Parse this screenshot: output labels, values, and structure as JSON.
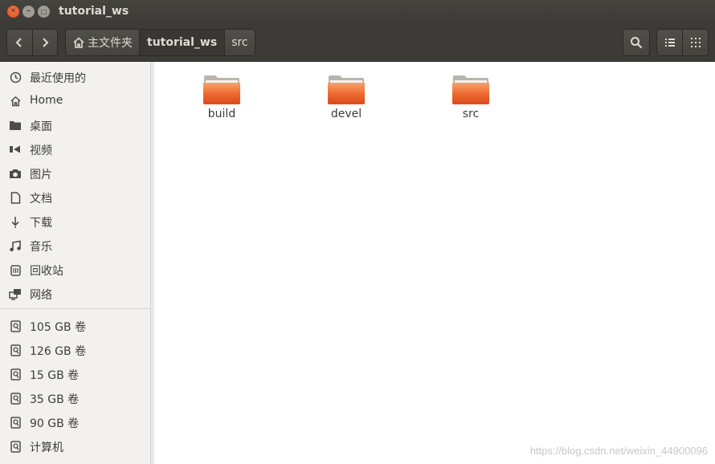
{
  "window": {
    "title": "tutorial_ws"
  },
  "toolbar": {
    "breadcrumbs": [
      {
        "label": "主文件夹"
      },
      {
        "label": "tutorial_ws"
      },
      {
        "label": "src"
      }
    ]
  },
  "sidebar": {
    "places": [
      {
        "label": "最近使用的",
        "icon": "clock-icon"
      },
      {
        "label": "Home",
        "icon": "home-icon"
      },
      {
        "label": "桌面",
        "icon": "desktop-folder-icon"
      },
      {
        "label": "视频",
        "icon": "video-icon"
      },
      {
        "label": "图片",
        "icon": "camera-icon"
      },
      {
        "label": "文档",
        "icon": "document-icon"
      },
      {
        "label": "下载",
        "icon": "download-icon"
      },
      {
        "label": "音乐",
        "icon": "music-icon"
      },
      {
        "label": "回收站",
        "icon": "trash-icon"
      },
      {
        "label": "网络",
        "icon": "network-icon"
      }
    ],
    "devices": [
      {
        "label": "105 GB 卷",
        "icon": "drive-icon"
      },
      {
        "label": "126 GB 卷",
        "icon": "drive-icon"
      },
      {
        "label": "15 GB 卷",
        "icon": "drive-icon"
      },
      {
        "label": "35 GB 卷",
        "icon": "drive-icon"
      },
      {
        "label": "90 GB 卷",
        "icon": "drive-icon"
      },
      {
        "label": "计算机",
        "icon": "computer-drive-icon"
      }
    ]
  },
  "files": [
    {
      "name": "build"
    },
    {
      "name": "devel"
    },
    {
      "name": "src"
    }
  ],
  "watermark": "https://blog.csdn.net/weixin_44900096",
  "colors": {
    "accent": "#e95420",
    "titlebar": "#3c3b37",
    "sidebar": "#f2f1f0"
  }
}
